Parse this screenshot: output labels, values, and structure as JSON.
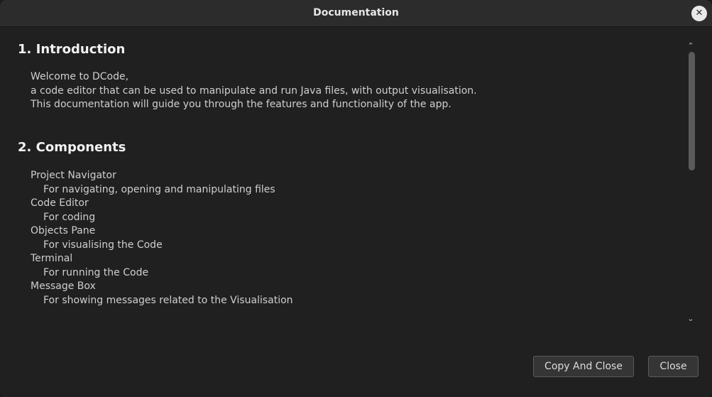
{
  "dialog": {
    "title": "Documentation",
    "close_icon": "✕"
  },
  "sections": [
    {
      "heading": "1. Introduction",
      "lines": [
        "Welcome to DCode,",
        "a code editor that can be used to manipulate and run Java files, with output visualisation.",
        "This documentation will guide you through the features and functionality of the app."
      ]
    },
    {
      "heading": "2. Components",
      "items": [
        {
          "name": "Project Navigator",
          "description": "For navigating, opening and manipulating files"
        },
        {
          "name": "Code Editor",
          "description": "For coding"
        },
        {
          "name": "Objects Pane",
          "description": "For visualising the Code"
        },
        {
          "name": "Terminal",
          "description": "For running the Code"
        },
        {
          "name": "Message Box",
          "description": "For showing messages related to the Visualisation"
        }
      ]
    }
  ],
  "scrollbar": {
    "up_icon": "⌃",
    "down_icon": "⌄"
  },
  "buttons": {
    "copy_and_close": "Copy And Close",
    "close": "Close"
  }
}
